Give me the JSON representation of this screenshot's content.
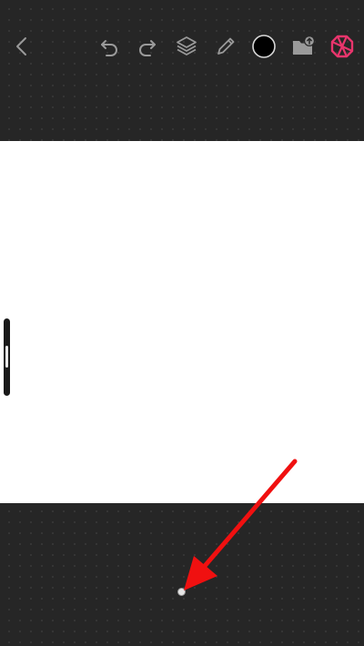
{
  "toolbar": {
    "icons": [
      "back-chevron-icon",
      "undo-icon",
      "redo-icon",
      "layers-icon",
      "pencil-icon",
      "color-swatch-icon",
      "folder-upload-icon",
      "app-logo-icon"
    ],
    "icon_color": "#9a9a9a",
    "active_color": "#000000",
    "brand_color": "#e8356c"
  },
  "canvas": {
    "background": "#ffffff"
  },
  "annotation": {
    "arrow_color": "#f01010"
  }
}
